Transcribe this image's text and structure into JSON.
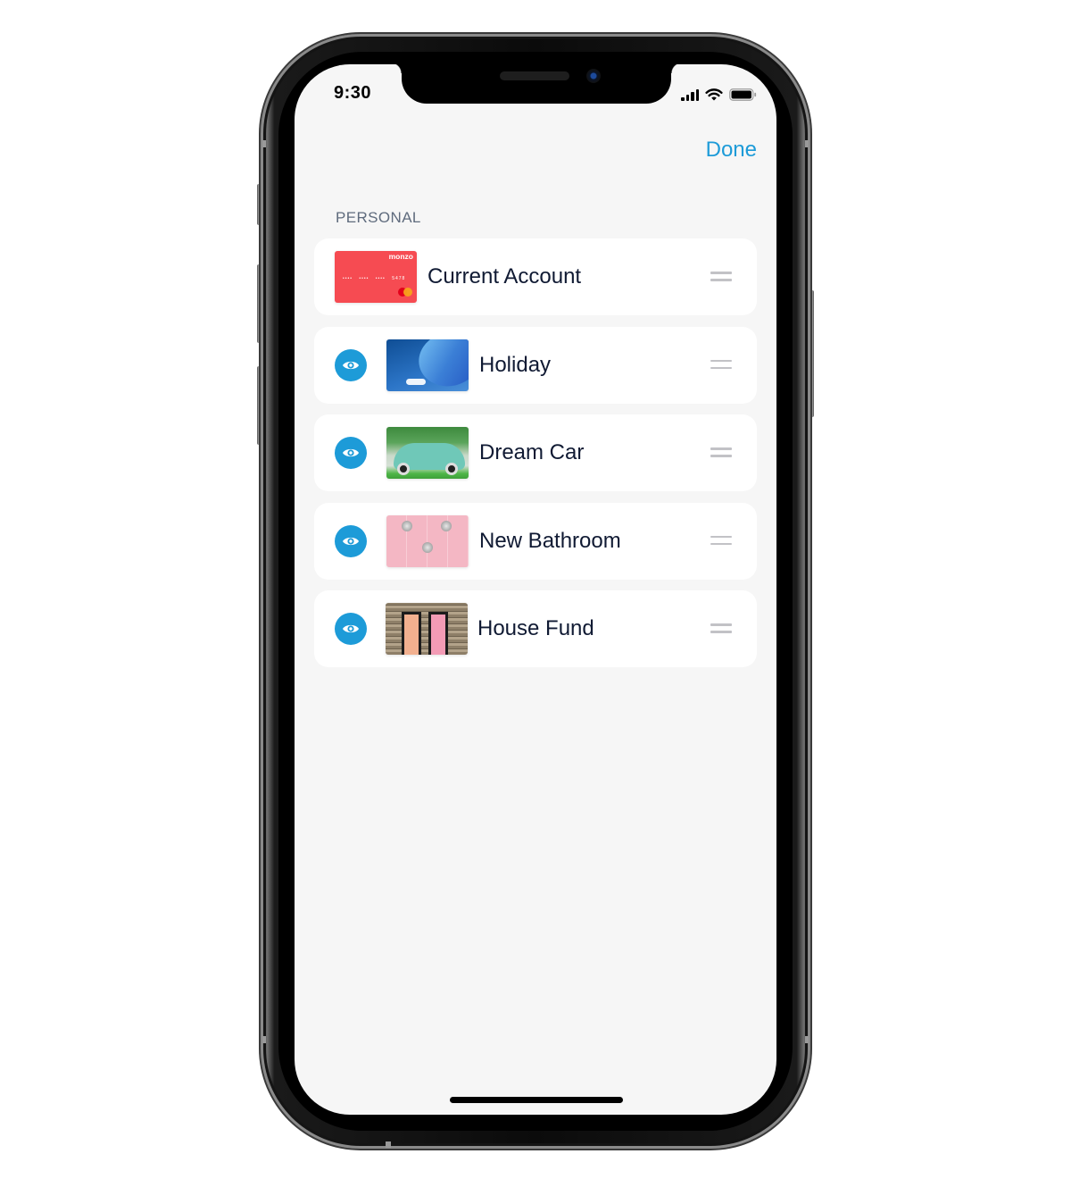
{
  "status_bar": {
    "time": "9:30",
    "icons": [
      "cellular-signal-icon",
      "wifi-icon",
      "battery-icon"
    ]
  },
  "nav": {
    "done_label": "Done"
  },
  "section": {
    "label": "PERSONAL"
  },
  "accounts": [
    {
      "label": "Current Account",
      "thumbnail": "monzo-card",
      "visibility_toggle": false,
      "card": {
        "brand": "monzo",
        "last_digits": "5478",
        "masked": "•••• •••• ••••"
      }
    },
    {
      "label": "Holiday",
      "thumbnail": "beach-umbrella-photo",
      "visibility_toggle": true
    },
    {
      "label": "Dream Car",
      "thumbnail": "vintage-car-photo",
      "visibility_toggle": true
    },
    {
      "label": "New Bathroom",
      "thumbnail": "pink-bathroom-taps-photo",
      "visibility_toggle": true
    },
    {
      "label": "House Fund",
      "thumbnail": "front-doors-photo",
      "visibility_toggle": true
    }
  ],
  "colors": {
    "accent": "#1d9bd8",
    "background": "#f6f6f6",
    "card_red": "#f64b52",
    "text_primary": "#101a33",
    "section_label": "#5f6b7d",
    "drag_handle": "#c2c2c6"
  }
}
